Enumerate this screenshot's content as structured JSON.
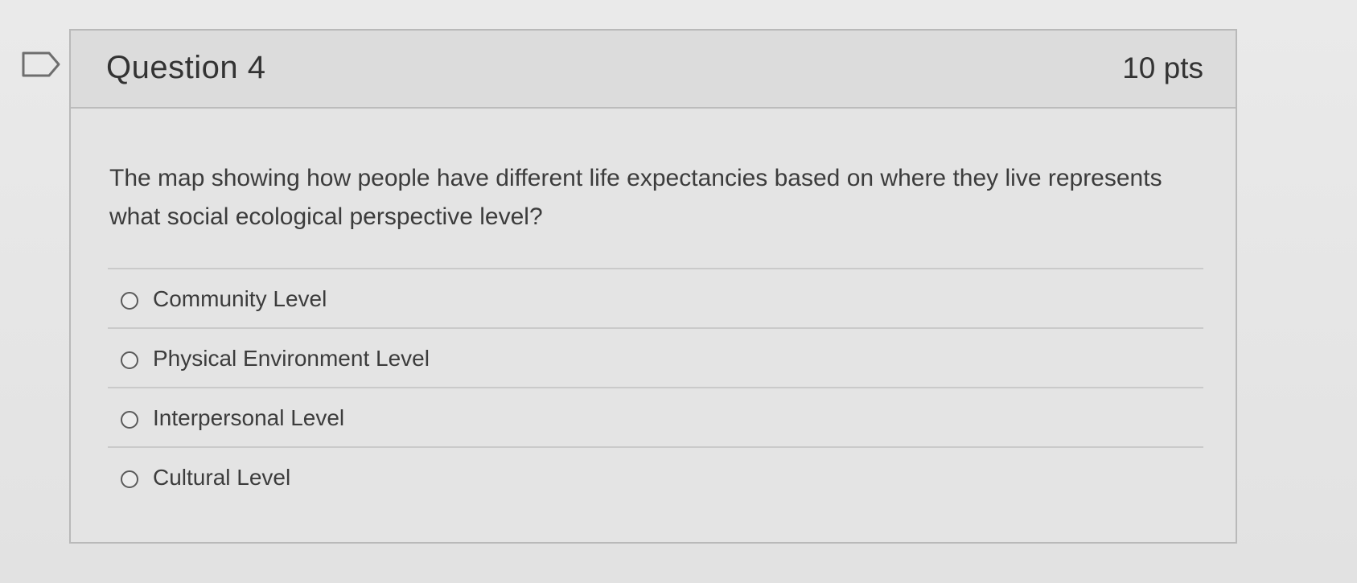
{
  "question": {
    "title": "Question 4",
    "points": "10 pts",
    "text": "The map showing how people have different life expectancies based on where they live represents what social ecological perspective level?"
  },
  "answers": [
    {
      "label": "Community Level",
      "selected": false
    },
    {
      "label": "Physical Environment Level",
      "selected": false
    },
    {
      "label": "Interpersonal Level",
      "selected": false
    },
    {
      "label": "Cultural Level",
      "selected": false
    }
  ],
  "colors": {
    "background": "#e6e6e6",
    "header": "#dcdcdc",
    "border": "#b9b9b9"
  }
}
